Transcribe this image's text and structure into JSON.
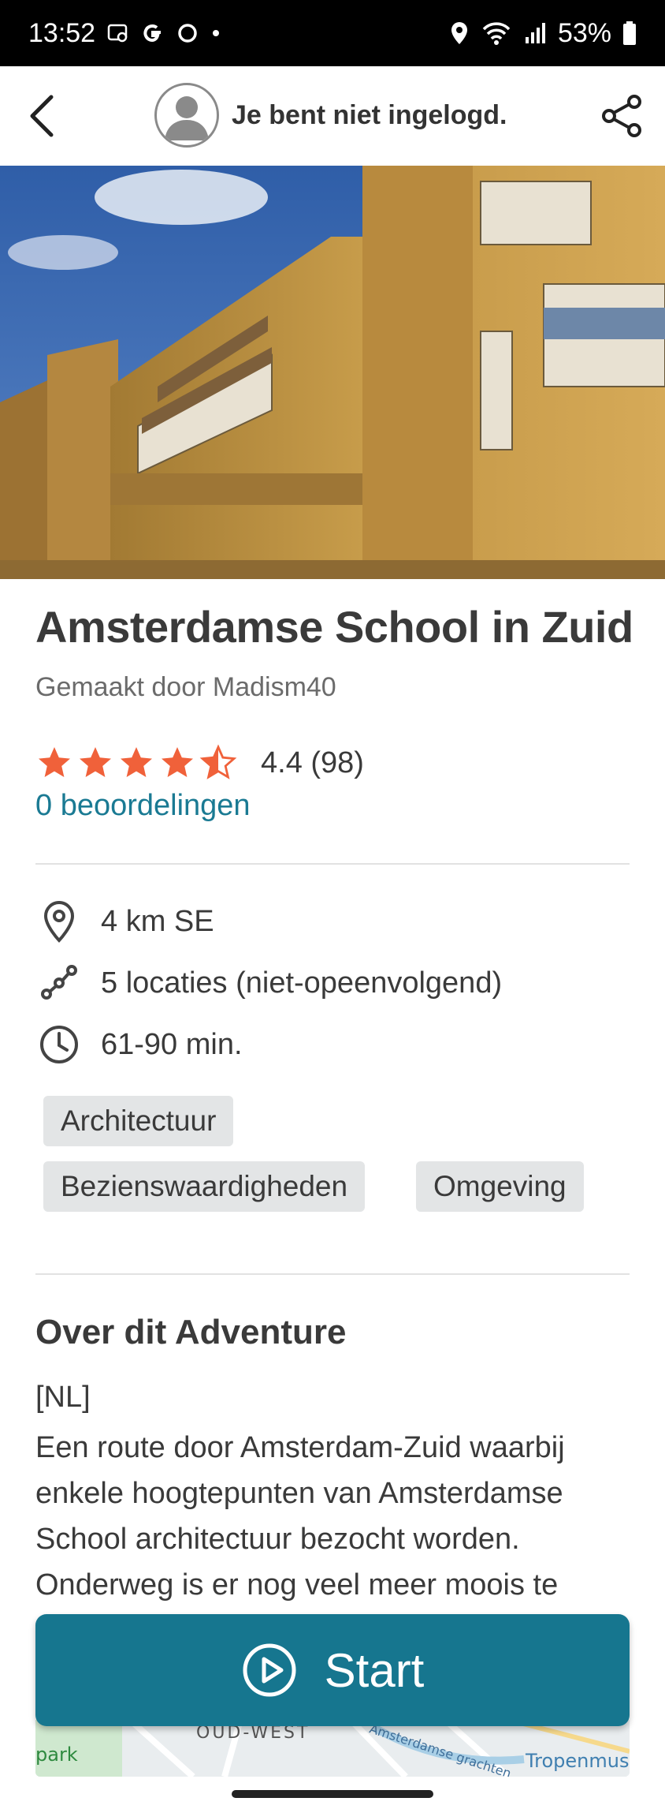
{
  "status_bar": {
    "time": "13:52",
    "battery": "53%",
    "icons": [
      "screen-record-icon",
      "google-g-icon",
      "sync-circle-icon",
      "dot-icon",
      "location-pin-icon",
      "wifi-icon",
      "signal-icon",
      "battery-icon"
    ]
  },
  "header": {
    "login_text": "Je bent niet ingelogd.",
    "back_icon": "chevron-left-icon",
    "share_icon": "share-icon"
  },
  "adventure": {
    "title": "Amsterdamse School in Zuid",
    "author": "Gemaakt door Madism40",
    "rating": 4.4,
    "rating_text": "4.4 (98)",
    "reviews_link": "0 beoordelingen",
    "distance": "4 km SE",
    "locations": "5 locaties (niet-opeenvolgend)",
    "duration": "61-90 min.",
    "tags": [
      "Architectuur",
      "Bezienswaardigheden",
      "Omgeving"
    ]
  },
  "about": {
    "heading": "Over dit Adventure",
    "lang": "[NL]",
    "body": "Een route door Amsterdam-Zuid waarbij enkele hoogtepunten van Amsterdamse School architectuur bezocht worden. Onderweg is er nog veel meer moois te"
  },
  "start_button": {
    "label": "Start"
  },
  "map_preview": {
    "labels": [
      "park",
      "OUD-WEST",
      "Amsterdamse grachten",
      "Tropenmus"
    ]
  },
  "colors": {
    "accent": "#16768f",
    "link": "#1a7a93",
    "star": "#f0613a",
    "tag_bg": "#e3e5e6"
  }
}
